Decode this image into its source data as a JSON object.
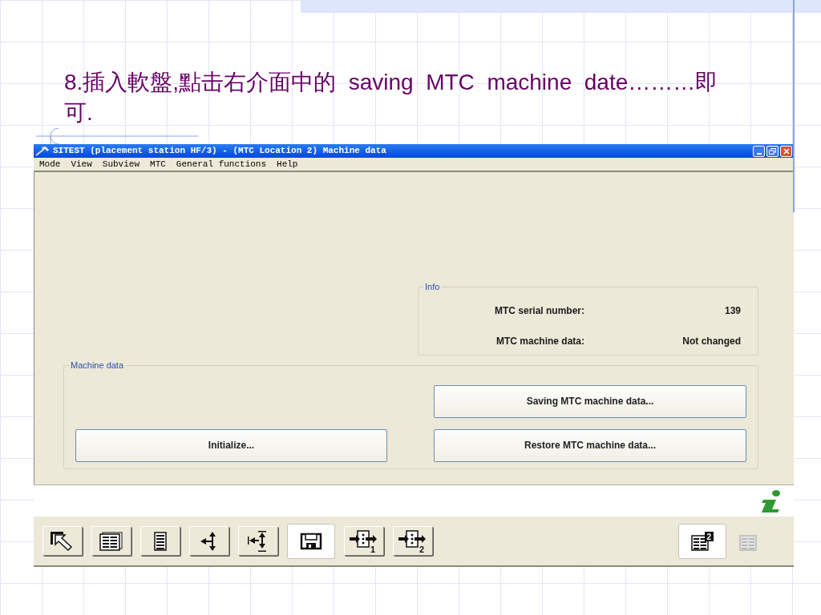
{
  "slide": {
    "title": "8.插入軟盤,點击右介面中的  saving  MTC  machine  date………即可."
  },
  "window": {
    "title": "SITEST (placement station HF/3) - (MTC Location 2) Machine data"
  },
  "menu": [
    "Mode",
    "View",
    "Subview",
    "MTC",
    "General functions",
    "Help"
  ],
  "info": {
    "legend": "Info",
    "rows": [
      {
        "label": "MTC serial number:",
        "value": "139"
      },
      {
        "label": "MTC machine data:",
        "value": "Not changed"
      }
    ]
  },
  "machine_data": {
    "legend": "Machine data",
    "save_button": "Saving MTC machine data...",
    "initialize_button": "Initialize...",
    "restore_button": "Restore MTC machine data..."
  },
  "toolbar_left": [
    {
      "kind": "pointer",
      "selected": false
    },
    {
      "kind": "table",
      "selected": false
    },
    {
      "kind": "list",
      "selected": false
    },
    {
      "kind": "arrows",
      "selected": false
    },
    {
      "kind": "span",
      "selected": false
    },
    {
      "kind": "floppy",
      "selected": true
    },
    {
      "kind": "transfer",
      "selected": false,
      "badge": "1"
    },
    {
      "kind": "transfer",
      "selected": false,
      "badge": "2"
    }
  ],
  "toolbar_right": [
    {
      "kind": "sheet",
      "selected": true,
      "disabled": false,
      "badge": "2"
    },
    {
      "kind": "sheet",
      "selected": false,
      "disabled": true
    }
  ]
}
